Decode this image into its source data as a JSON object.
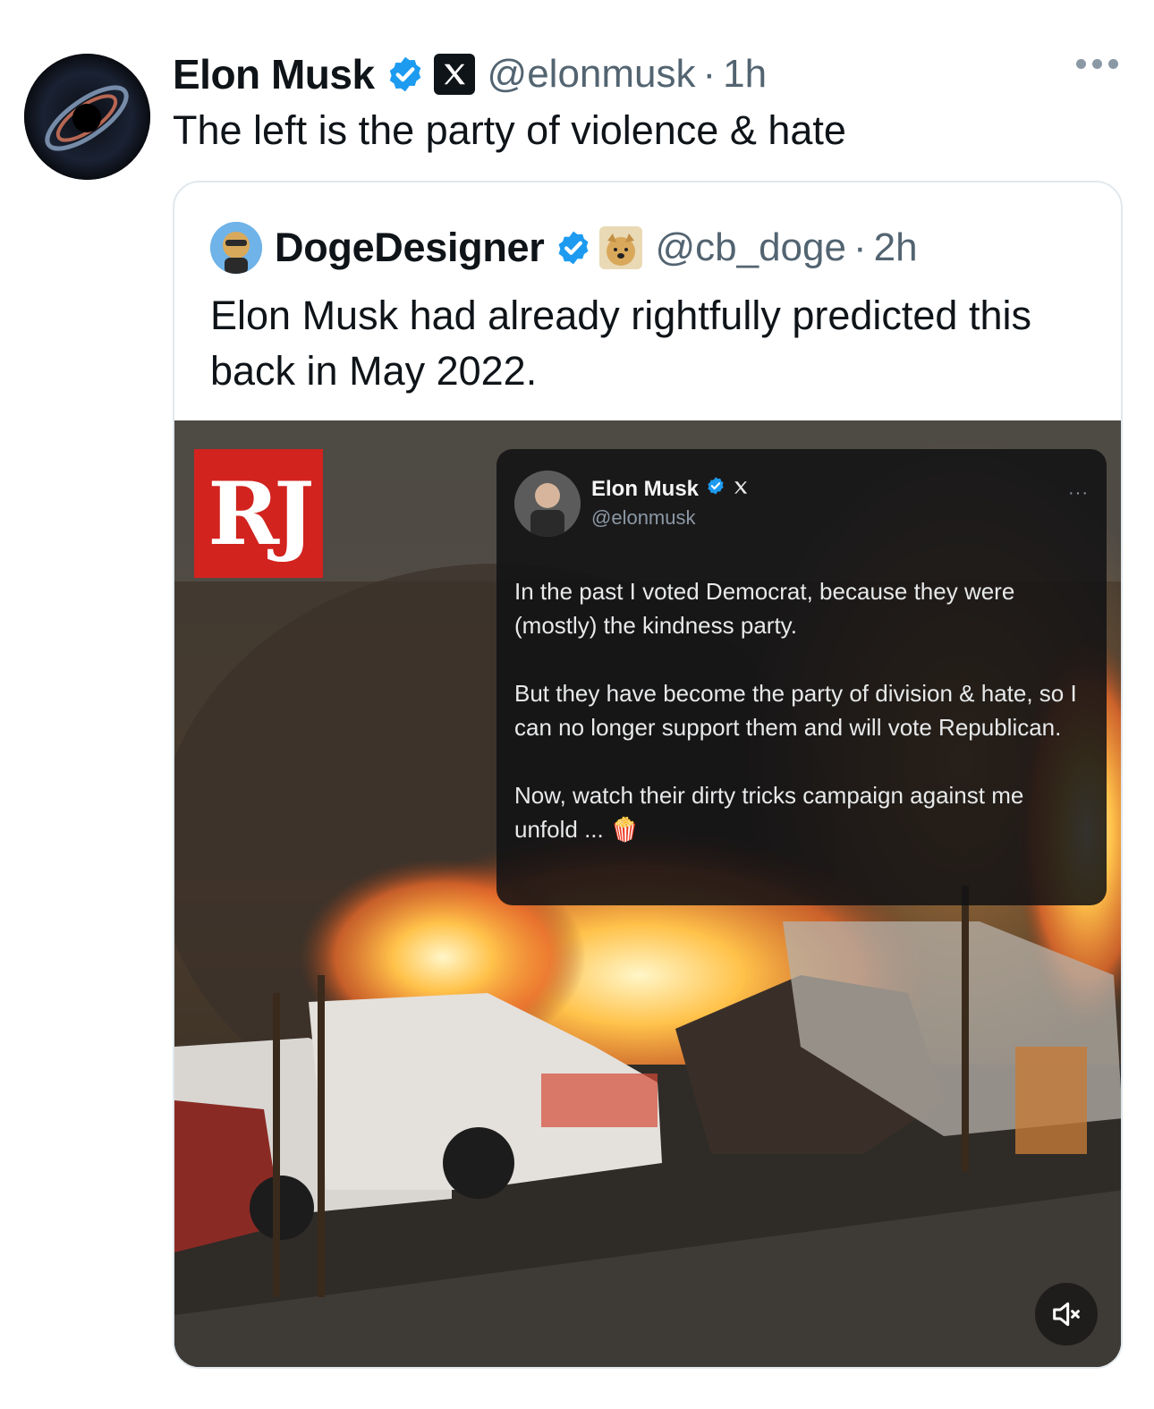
{
  "tweet": {
    "author_name": "Elon Musk",
    "handle": "@elonmusk",
    "separator": "·",
    "time": "1h",
    "text": "The left is the party of violence & hate"
  },
  "quote": {
    "author_name": "DogeDesigner",
    "handle": "@cb_doge",
    "separator": "·",
    "time": "2h",
    "text": "Elon Musk had already rightfully predicted this back in May 2022."
  },
  "media": {
    "logo_text": "RJ",
    "embedded_tweet": {
      "author_name": "Elon Musk",
      "handle": "@elonmusk",
      "paragraph_1": "In the past I voted Democrat, because they were (mostly) the kindness party.",
      "paragraph_2": "But they have become the party of division & hate, so I can no longer support them and will vote Republican.",
      "paragraph_3": "Now, watch their dirty tricks campaign against me unfold ... 🍿"
    }
  },
  "icons": {
    "verified": "verified-badge-icon",
    "x_logo": "x-logo-icon",
    "more": "more-options-icon",
    "mute": "muted-speaker-icon"
  },
  "colors": {
    "verified": "#1d9bf0",
    "secondary_text": "#536471",
    "rj_red": "#d2231f"
  }
}
